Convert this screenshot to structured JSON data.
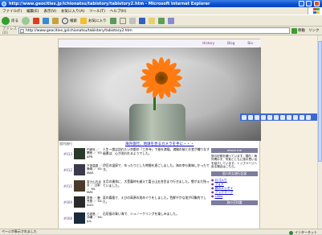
{
  "window": {
    "title": "http://www.geocities.jp/ichionatsu/tabistory/tabistory2.htm - Microsoft Internet Explorer"
  },
  "menu": {
    "items": [
      "ファイル(F)",
      "編集(E)",
      "表示(V)",
      "お気に入り(A)",
      "ツール(T)",
      "ヘルプ(H)"
    ]
  },
  "toolbar": {
    "back": "戻る",
    "search": "検索",
    "favorites": "お気に入り"
  },
  "address": {
    "label": "アドレス(D)",
    "url": "http://www.geocities.jp/ichionatsu/tabistory/tabistory2.htm",
    "go": "移動",
    "links": "リンク"
  },
  "site": {
    "nav": [
      "History",
      "Blog",
      "Bio"
    ],
    "caption_home": "国内旅行",
    "news_link": "海外旅行、地球を見るカメラを手に・・・",
    "entries": [
      {
        "num": "#013",
        "meta": "円城寺 ／ 関西 ／ '05. APR.",
        "desc": "人生一度は訪れたい京都の「三井寺」で桜を満喫。満開の桜とお堂が織りなす風景は、心が洗われるようでした。"
      },
      {
        "num": "#012",
        "meta": "下田温泉 ／ 静岡 ／ '05. MAR.",
        "desc": "伊豆の温泉で、ゆったりとした時間を過ごしました。海の幸も美味しかったです。"
      },
      {
        "num": "#011",
        "meta": "富士山五合目 ／ 山梨 ／ '05. MAY.",
        "desc": "五月の連休に、大菩薩峠を越えて富士山五合目まで行きました。雪がまだ残っていました。"
      },
      {
        "num": "#009",
        "meta": "霧島 ／ 鹿児島 ／ '04. AUG.",
        "desc": "夏の霧島で、えびの高原の池めぐりをしました。色鮮やかな池が印象的でした。"
      },
      {
        "num": "#008",
        "meta": "石垣島 ／ 沖縄 ／ '04. JUL.",
        "desc": "石垣島の青い海で、シュノーケリングを楽しみました。"
      }
    ],
    "sidebar": {
      "about_header": "about me",
      "about_text": "旅の記録を綴っています。国内・海外問わず、写真とともに旅の思い出を紹介しています。トップページへ戻る場合はこちら。",
      "links_header": "個人的な旅行記録",
      "links": [
        "ロゴ入り",
        "フォト",
        "旅のエッセイ",
        "ブックマーク",
        "Links"
      ],
      "links2_header": "旅の豆知識"
    }
  },
  "status": {
    "left": "ページが表示されました",
    "zone": "インターネット"
  }
}
